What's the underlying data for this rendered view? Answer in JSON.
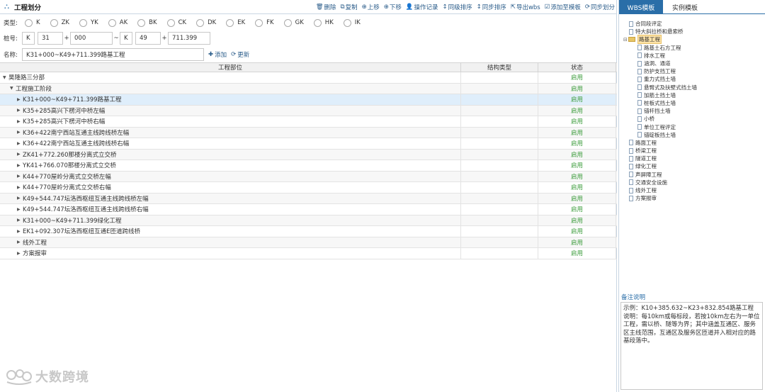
{
  "header": {
    "title": "工程划分",
    "toolbar": [
      {
        "icon": "trash-icon",
        "glyph": "🗑",
        "label": "删除"
      },
      {
        "icon": "copy-icon",
        "glyph": "⧉",
        "label": "复制"
      },
      {
        "icon": "move-up-icon",
        "glyph": "⊕",
        "label": "上移"
      },
      {
        "icon": "move-down-icon",
        "glyph": "⊕",
        "label": "下移"
      },
      {
        "icon": "user-icon",
        "glyph": "👤",
        "label": "操作记录"
      },
      {
        "icon": "sort-icon",
        "glyph": "↕",
        "label": "同级排序"
      },
      {
        "icon": "sync-sort-icon",
        "glyph": "↕",
        "label": "同步排序"
      },
      {
        "icon": "export-icon",
        "glyph": "⇱",
        "label": "导出wbs"
      },
      {
        "icon": "check-icon",
        "glyph": "☑",
        "label": "添加至模板"
      },
      {
        "icon": "sync-icon",
        "glyph": "⟳",
        "label": "同步划分"
      }
    ]
  },
  "form": {
    "type_label": "类型:",
    "types": [
      "K",
      "ZK",
      "YK",
      "AK",
      "BK",
      "CK",
      "DK",
      "EK",
      "FK",
      "GK",
      "HK",
      "IK"
    ],
    "stake_label": "桩号:",
    "stake": {
      "p1": "K",
      "p2": "31",
      "p3": "000",
      "p4": "K",
      "p5": "49",
      "p6": "711.399"
    },
    "name_label": "名称:",
    "name_value": "K31+000~K49+711.399路基工程",
    "add_label": "添加",
    "update_label": "更新"
  },
  "grid": {
    "headers": [
      "工程部位",
      "结构类型",
      "状态"
    ],
    "rows": [
      {
        "name": "昊隆路三分部",
        "level": 0,
        "expanded": true,
        "type": "",
        "status": "启用"
      },
      {
        "name": "工程施工阶段",
        "level": 1,
        "expanded": true,
        "type": "",
        "status": "启用"
      },
      {
        "name": "K31+000~K49+711.399路基工程",
        "level": 2,
        "expanded": false,
        "type": "",
        "status": "启用",
        "selected": true
      },
      {
        "name": "K35+285高兴下楞河中桥左幅",
        "level": 2,
        "expanded": false,
        "type": "",
        "status": "启用"
      },
      {
        "name": "K35+285高兴下楞河中桥右幅",
        "level": 2,
        "expanded": false,
        "type": "",
        "status": "启用"
      },
      {
        "name": "K36+422南宁西站互通主线跨线桥左幅",
        "level": 2,
        "expanded": false,
        "type": "",
        "status": "启用"
      },
      {
        "name": "K36+422南宁西站互通主线跨线桥右幅",
        "level": 2,
        "expanded": false,
        "type": "",
        "status": "启用"
      },
      {
        "name": "ZK41+772.260那楼分离式立交桥",
        "level": 2,
        "expanded": false,
        "type": "",
        "status": "启用"
      },
      {
        "name": "YK41+766.070那楼分离式立交桥",
        "level": 2,
        "expanded": false,
        "type": "",
        "status": "启用"
      },
      {
        "name": "K44+770屋岭分离式立交桥左幅",
        "level": 2,
        "expanded": false,
        "type": "",
        "status": "启用"
      },
      {
        "name": "K44+770屋岭分离式立交桥右幅",
        "level": 2,
        "expanded": false,
        "type": "",
        "status": "启用"
      },
      {
        "name": "K49+544.747坛洛西枢纽互通主线跨线桥左幅",
        "level": 2,
        "expanded": false,
        "type": "",
        "status": "启用"
      },
      {
        "name": "K49+544.747坛洛西枢纽互通主线跨线桥右幅",
        "level": 2,
        "expanded": false,
        "type": "",
        "status": "启用"
      },
      {
        "name": "K31+000~K49+711.399绿化工程",
        "level": 2,
        "expanded": false,
        "type": "",
        "status": "启用"
      },
      {
        "name": "EK1+092.307坛洛西枢纽互通E匝道跨线桥",
        "level": 2,
        "expanded": false,
        "type": "",
        "status": "启用"
      },
      {
        "name": "线外工程",
        "level": 2,
        "expanded": false,
        "type": "",
        "status": "启用"
      },
      {
        "name": "方案报审",
        "level": 2,
        "expanded": false,
        "type": "",
        "status": "启用"
      }
    ]
  },
  "watermark": "大数跨境",
  "right": {
    "tabs": [
      "WBS模板",
      "实例模板"
    ],
    "tree": [
      {
        "label": "合同段评定",
        "level": 0,
        "kind": "doc"
      },
      {
        "label": "特大斜拉桥和悬索桥",
        "level": 0,
        "kind": "doc"
      },
      {
        "label": "路基工程",
        "level": 0,
        "kind": "folder",
        "highlight": true
      },
      {
        "label": "路基土石方工程",
        "level": 1,
        "kind": "doc"
      },
      {
        "label": "排水工程",
        "level": 1,
        "kind": "doc"
      },
      {
        "label": "涵洞、通道",
        "level": 1,
        "kind": "doc"
      },
      {
        "label": "防护支挡工程",
        "level": 1,
        "kind": "doc"
      },
      {
        "label": "重力式挡土墙",
        "level": 1,
        "kind": "doc"
      },
      {
        "label": "悬臂式及扶壁式挡土墙",
        "level": 1,
        "kind": "doc"
      },
      {
        "label": "加筋土挡土墙",
        "level": 1,
        "kind": "doc"
      },
      {
        "label": "桩板式挡土墙",
        "level": 1,
        "kind": "doc"
      },
      {
        "label": "锚杆挡土墙",
        "level": 1,
        "kind": "doc"
      },
      {
        "label": "小桥",
        "level": 1,
        "kind": "doc"
      },
      {
        "label": "单位工程评定",
        "level": 1,
        "kind": "doc"
      },
      {
        "label": "锚碇板挡土墙",
        "level": 1,
        "kind": "doc"
      },
      {
        "label": "路面工程",
        "level": 0,
        "kind": "doc"
      },
      {
        "label": "桥梁工程",
        "level": 0,
        "kind": "doc"
      },
      {
        "label": "隧道工程",
        "level": 0,
        "kind": "doc"
      },
      {
        "label": "绿化工程",
        "level": 0,
        "kind": "doc"
      },
      {
        "label": "声屏障工程",
        "level": 0,
        "kind": "doc"
      },
      {
        "label": "交通安全设施",
        "level": 0,
        "kind": "doc"
      },
      {
        "label": "线外工程",
        "level": 0,
        "kind": "doc"
      },
      {
        "label": "方案报审",
        "level": 0,
        "kind": "doc"
      }
    ],
    "notes_title": "备注说明",
    "notes_text": "示例：K10+385.632~K23+832.854路基工程 说明：每10km或每标段，若按10km左右为一单位工程，需以桥、隧等为界；其中涵盖互通区、服务区主线范围，互通区及服务区匝道并入相对应的路基段落中。"
  }
}
